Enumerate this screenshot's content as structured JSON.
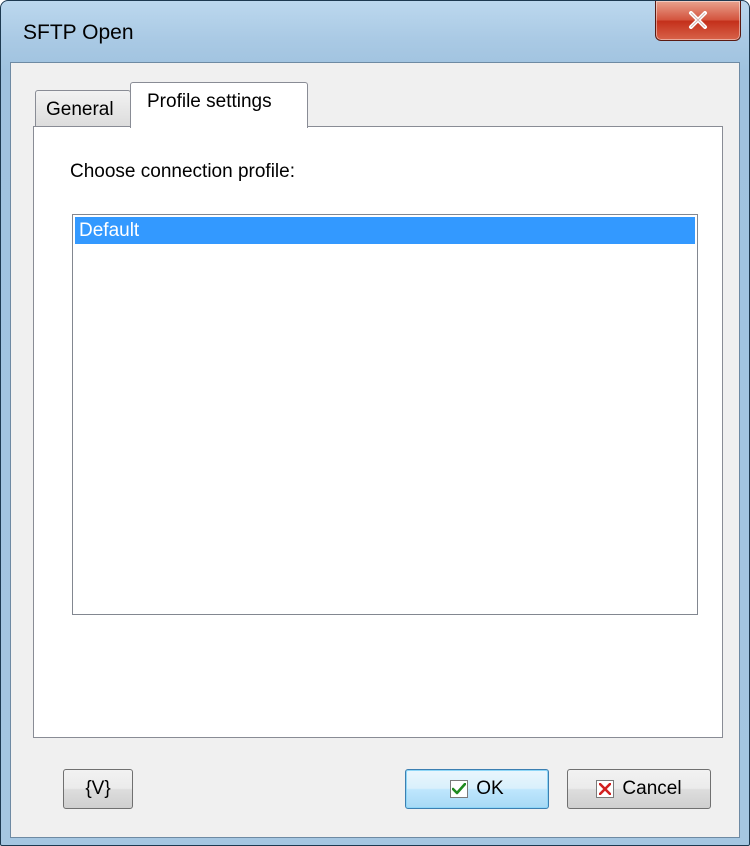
{
  "window": {
    "title": "SFTP Open",
    "close_icon": "close-icon"
  },
  "tabs": [
    {
      "label": "General",
      "selected": false
    },
    {
      "label": "Profile settings",
      "selected": true
    }
  ],
  "profile": {
    "label": "Choose connection profile:",
    "items": [
      {
        "label": "Default",
        "selected": true
      }
    ]
  },
  "buttons": {
    "variables_label": "{V}",
    "ok_label": "OK",
    "cancel_label": "Cancel",
    "ok_icon": "checkmark-icon",
    "cancel_icon": "x-icon"
  },
  "colors": {
    "selection": "#3399ff",
    "frame": "#a9c9e4",
    "close_button": "#c4301b"
  }
}
